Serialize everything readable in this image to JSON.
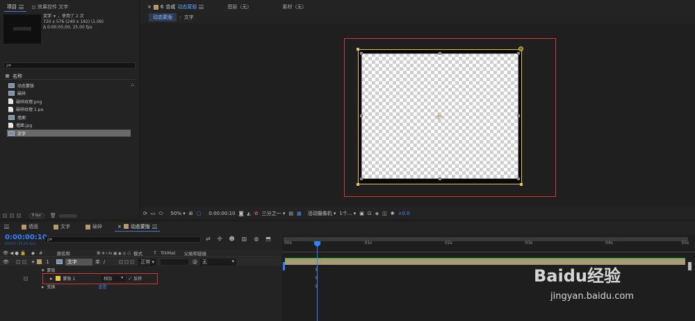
{
  "project_panel": {
    "tabs": [
      {
        "label": "项目",
        "active": true
      },
      {
        "label": "效果控件 文字",
        "active": false
      }
    ],
    "preview": {
      "name": "文字",
      "used": "，使用了 2 次",
      "dims": "720 x 576  (240 x 192) (1.09)",
      "duration": "Δ 0:00:05:00, 25.00 fps"
    },
    "search_placeholder": "ρ▾",
    "column_name": "名称",
    "items": [
      {
        "label": "动态蒙版",
        "type": "comp"
      },
      {
        "label": "破碎",
        "type": "comp"
      },
      {
        "label": "破碎纹理.png",
        "type": "file"
      },
      {
        "label": "破碎纹理 1.pa",
        "type": "file"
      },
      {
        "label": "墙面",
        "type": "comp"
      },
      {
        "label": "墙面.jpg",
        "type": "file"
      },
      {
        "label": "文字",
        "type": "comp",
        "selected": true
      }
    ],
    "bpc": "8 bpc"
  },
  "composition_panel": {
    "close": "×",
    "lock": "6",
    "title_prefix": "合成",
    "title": "动态蒙版",
    "layer_panel": "图层（无）",
    "footage_panel": "素材（无）",
    "breadcrumb": [
      "动态蒙版",
      "文字"
    ],
    "zoom": "50%",
    "timecode": "0:00:00:10",
    "resolution": "三分之一",
    "camera": "活动摄像机",
    "views": "1个...",
    "exposure": "+0.0"
  },
  "timeline": {
    "tabs": [
      {
        "label": "墙面",
        "color": "#b69a6a"
      },
      {
        "label": "文字",
        "color": "#b69a6a"
      },
      {
        "label": "破碎",
        "color": "#b69a6a"
      },
      {
        "label": "动态蒙版",
        "color": "#b69a6a",
        "active": true
      }
    ],
    "current_time": "0:00:00:10",
    "frame_info": "00010 (25.00 fps)",
    "search_placeholder": "ρ▾",
    "columns": {
      "source_name": "源名称",
      "switches": "单 ✲ \\ fx ▦ ◉ ◎ ⬡",
      "mode": "模式",
      "t": "T",
      "trkmat": "TrkMat",
      "parent": "父级和链接"
    },
    "layer": {
      "index": "1",
      "name": "文字",
      "mode": "正常",
      "parent": "无",
      "switch_char": "单"
    },
    "mask_group": "蒙版",
    "mask": {
      "name": "蒙版 1",
      "mode": "相加",
      "inverted": "反转"
    },
    "transform": "变换",
    "transform_reset": "重置",
    "ruler": [
      "00s",
      "01s",
      "02s",
      "03s",
      "04s",
      "05s"
    ]
  },
  "watermark": {
    "brand": "Baidu经验",
    "url": "jingyan.baidu.com"
  },
  "colors": {
    "accent_blue": "#3f7dd9",
    "layer_bar": "#a99a7a",
    "highlight_red": "#d1383a",
    "mask_yellow": "#e5c74b",
    "timecode_blue": "#2f83ff"
  }
}
